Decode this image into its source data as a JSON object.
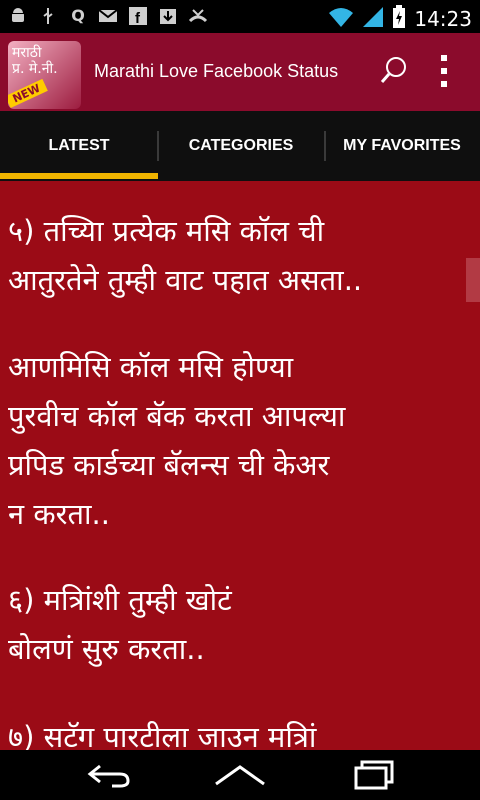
{
  "status_bar": {
    "time": "14:23",
    "left_icons": [
      "android-icon",
      "usb-icon",
      "q-icon",
      "mail-icon",
      "facebook-icon",
      "download-icon",
      "missed-call-icon"
    ],
    "right_icons": [
      "wifi-icon",
      "signal-icon",
      "battery-icon"
    ]
  },
  "app_bar": {
    "logo_text": "मराठी\nप्र. मे.नी.",
    "logo_badge": "NEW",
    "title": "Marathi Love Facebook Status"
  },
  "tabs": [
    {
      "label": "LATEST",
      "selected": true
    },
    {
      "label": "CATEGORIES",
      "selected": false
    },
    {
      "label": "MY FAVORITES",
      "selected": false
    }
  ],
  "content": {
    "paragraphs": [
      "५) तच्यिा प्रत्येक मसि कॉल ची\nआतुरतेने तुम्ही वाट पहात असता..",
      "आणमिसि कॉल मसि होण्या\nपुरवीच कॉल बॅक करता आपल्या\nप्रपिड कार्डच्या बॅलन्स ची केअर\nन करता..",
      "६) मत्रिांशी तुम्ही खोटं\nबोलणं सुरु करता..",
      "७) सटॅग पारटीला जाउन मत्रिां"
    ]
  },
  "colors": {
    "app_bar": "#8b0b2c",
    "content_bg": "#9b0b16",
    "tab_indicator": "#f0b400"
  },
  "nav_bar": {
    "buttons": [
      "back-icon",
      "home-icon",
      "recents-icon"
    ]
  }
}
